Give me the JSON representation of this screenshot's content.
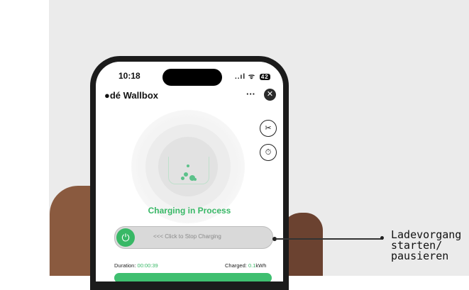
{
  "status_bar": {
    "time": "10:18",
    "signal": "..ıl",
    "wifi": "ᯤ",
    "battery": "42"
  },
  "app": {
    "title": "dé Wallbox",
    "more": "···",
    "close": "✕"
  },
  "side_buttons": {
    "tools_icon": "✂",
    "timer_icon": "⏱"
  },
  "charging": {
    "status": "Charging in Process",
    "slider_label": "<<< Click to Stop Charging",
    "power_icon": "⏻"
  },
  "stats": {
    "duration_label": "Duration:",
    "duration_value": "00:00:39",
    "charged_label": "Charged:",
    "charged_value": "0.1",
    "charged_unit": "kWh"
  },
  "callout": {
    "text": "Ladevorgang\nstarten/\npausieren"
  },
  "colors": {
    "accent_green": "#38b866",
    "background": "#ebebeb"
  }
}
